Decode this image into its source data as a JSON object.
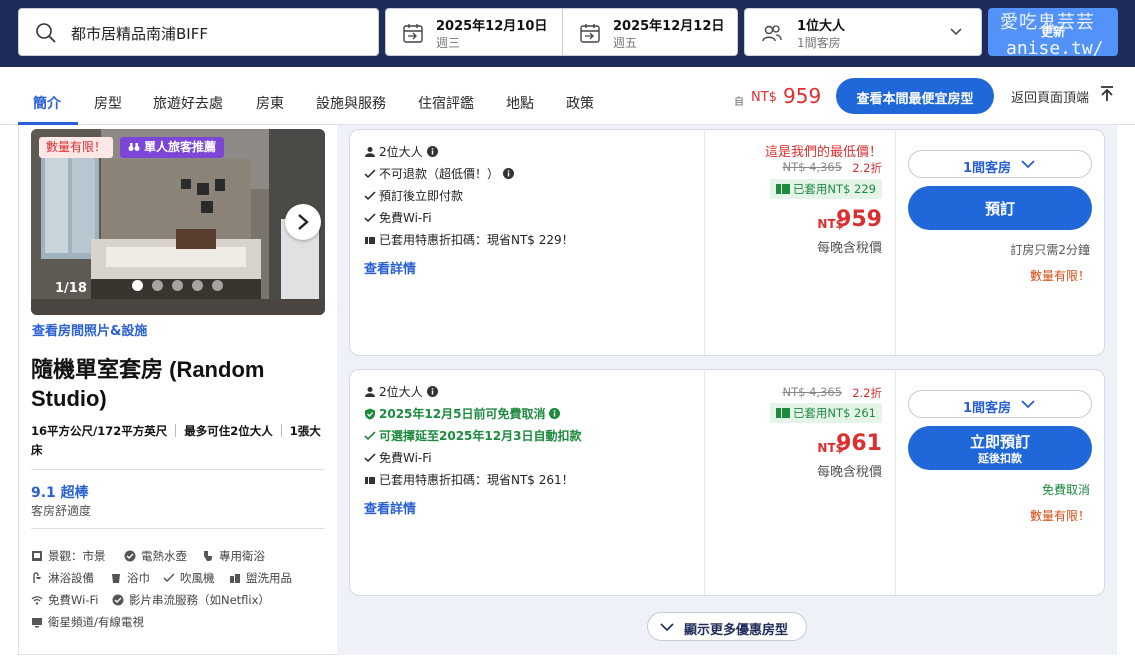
{
  "search": {
    "destination": "都市居精品南浦BIFF",
    "checkin_date": "2025年12月10日",
    "checkin_day": "週三",
    "checkout_date": "2025年12月12日",
    "checkout_day": "週五",
    "guests": "1位大人",
    "rooms": "1間客房",
    "update_label": "更新"
  },
  "watermark": {
    "line1": "愛吃鬼芸芸",
    "line2": "anise.tw/"
  },
  "nav": {
    "tabs": [
      "簡介",
      "房型",
      "旅遊好去處",
      "房東",
      "設施與服務",
      "住宿評鑑",
      "地點",
      "政策"
    ],
    "price_from": "自",
    "currency": "NT$",
    "price": "959",
    "cheapest_label": "查看本間最便宜房型",
    "back_to_top": "返回頁面頂端"
  },
  "room": {
    "badge_limited": "數量有限！",
    "badge_solo": "單人旅客推薦",
    "photo_counter": "1/18",
    "photo_count_shown": 5,
    "photo_index": 1,
    "photos_link": "查看房間照片&設施",
    "title": "隨機單室套房 (Random Studio)",
    "size": "16平方公尺/172平方英尺",
    "occupancy": "最多可住2位大人",
    "bed": "1張大床",
    "score": "9.1 超棒",
    "score_label": "客房舒適度",
    "facilities": [
      {
        "icon": "view-icon",
        "label": "景觀：市景"
      },
      {
        "icon": "kettle-icon",
        "label": "電熱水壺"
      },
      {
        "icon": "toilet-icon",
        "label": "專用衛浴"
      },
      {
        "icon": "shower-icon",
        "label": "淋浴設備"
      },
      {
        "icon": "towel-icon",
        "label": "浴巾"
      },
      {
        "icon": "check-icon",
        "label": "吹風機"
      },
      {
        "icon": "toiletries-icon",
        "label": "盥洗用品"
      },
      {
        "icon": "wifi-icon",
        "label": "免費Wi-Fi"
      },
      {
        "icon": "check-icon",
        "label": "影片串流服務（如Netflix）"
      },
      {
        "icon": "tv-icon",
        "label": "衛星頻道/有線電視"
      }
    ]
  },
  "offers": [
    {
      "features": [
        {
          "icon": "person-icon",
          "text": "2位大人",
          "info": true,
          "green": false
        },
        {
          "icon": "check-icon",
          "text": "不可退款（超低價！）",
          "info": true,
          "green": false
        },
        {
          "icon": "check-icon",
          "text": "預訂後立即付款",
          "info": false,
          "green": false
        },
        {
          "icon": "check-icon",
          "text": "免費Wi-Fi",
          "info": false,
          "green": false
        },
        {
          "icon": "ticket-icon",
          "text": "已套用特惠折扣碼：現省NT$ 229！",
          "info": false,
          "green": false
        }
      ],
      "details": "查看詳情",
      "lowest_label": "這是我們的最低價！",
      "original_price": "NT$ 4,365",
      "discount": "2.2折",
      "coupon": "已套用NT$ 229",
      "currency": "NT$",
      "price": "959",
      "tax_note": "每晚含稅價",
      "rooms": "1間客房",
      "book_label": "預訂",
      "book_sub": "",
      "note1": "訂房只需2分鐘",
      "note2": "數量有限！"
    },
    {
      "features": [
        {
          "icon": "person-icon",
          "text": "2位大人",
          "info": true,
          "green": false
        },
        {
          "icon": "shield-icon",
          "text": "2025年12月5日前可免費取消",
          "info": true,
          "green": true
        },
        {
          "icon": "check-icon",
          "text": "可選擇延至2025年12月3日自動扣款",
          "info": false,
          "green": true
        },
        {
          "icon": "check-icon",
          "text": "免費Wi-Fi",
          "info": false,
          "green": false
        },
        {
          "icon": "ticket-icon",
          "text": "已套用特惠折扣碼：現省NT$ 261！",
          "info": false,
          "green": false
        }
      ],
      "details": "查看詳情",
      "lowest_label": "",
      "original_price": "NT$ 4,365",
      "discount": "2.2折",
      "coupon": "已套用NT$ 261",
      "currency": "NT$",
      "price": "961",
      "tax_note": "每晚含稅價",
      "rooms": "1間客房",
      "book_label": "立即預訂",
      "book_sub": "延後扣款",
      "note1": "免費取消",
      "note2": "數量有限！"
    }
  ],
  "more_label": "顯示更多優惠房型",
  "colors": {
    "header_bg": "#1f2c59",
    "accent": "#2067da",
    "price_red": "#e12d2d",
    "green": "#1d8a3e",
    "purple_badge": "#7c46d6"
  }
}
